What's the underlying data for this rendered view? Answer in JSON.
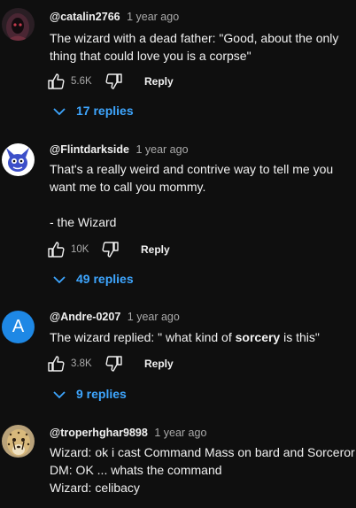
{
  "comments": [
    {
      "author": "@catalin2766",
      "time": "1 year ago",
      "text": "The wizard with a dead father: \"Good, about the only thing that could love you is a corpse\"",
      "likes": "5.6K",
      "reply_label": "Reply",
      "replies_label": "17 replies",
      "avatar_icon": "hooded-figure-avatar-icon"
    },
    {
      "author": "@Flintdarkside",
      "time": "1 year ago",
      "text": "That's a really weird and contrive way to tell me you want me to call you mommy.\n\n- the Wizard",
      "likes": "10K",
      "reply_label": "Reply",
      "replies_label": "49 replies",
      "avatar_icon": "cartoon-creature-avatar-icon"
    },
    {
      "author": "@Andre-0207",
      "time": "1 year ago",
      "text_before": "The wizard replied: \" what kind of ",
      "text_bold": "sorcery",
      "text_after": " is this\"",
      "likes": "3.8K",
      "reply_label": "Reply",
      "replies_label": "9 replies",
      "avatar_letter": "A",
      "avatar_color": "#1e88e5"
    },
    {
      "author": "@troperhghar9898",
      "time": "1 year ago",
      "text": "Wizard: ok i cast Command Mass on bard and Sorceror\nDM: OK ... whats the command\nWizard: celibacy",
      "avatar_icon": "cheetah-avatar-icon"
    }
  ],
  "colors": {
    "background": "#0f0f0f",
    "link_blue": "#3ea6ff",
    "secondary_text": "#aaaaaa"
  }
}
